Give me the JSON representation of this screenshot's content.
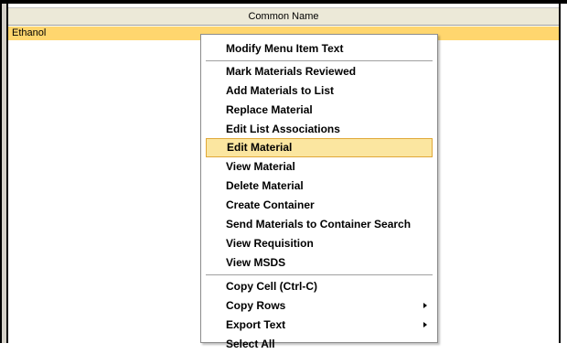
{
  "grid": {
    "column_header": "Common Name",
    "selected_row_value": "Ethanol"
  },
  "context_menu": {
    "items": [
      {
        "label": "Modify Menu Item Text"
      },
      {
        "label": "Mark Materials Reviewed"
      },
      {
        "label": "Add Materials to List"
      },
      {
        "label": "Replace Material"
      },
      {
        "label": "Edit List Associations"
      },
      {
        "label": "Edit Material",
        "highlighted": true
      },
      {
        "label": "View Material"
      },
      {
        "label": "Delete Material"
      },
      {
        "label": "Create Container"
      },
      {
        "label": "Send Materials to Container Search"
      },
      {
        "label": "View Requisition"
      },
      {
        "label": "View MSDS"
      },
      {
        "label": "Copy Cell  (Ctrl-C)"
      },
      {
        "label": "Copy Rows",
        "has_submenu": true
      },
      {
        "label": "Export Text",
        "has_submenu": true
      },
      {
        "label": "Select All"
      }
    ]
  },
  "colors": {
    "selected_row": "#ffd66e",
    "menu_highlight": "#fbe6a0",
    "menu_highlight_border": "#e0a838"
  }
}
